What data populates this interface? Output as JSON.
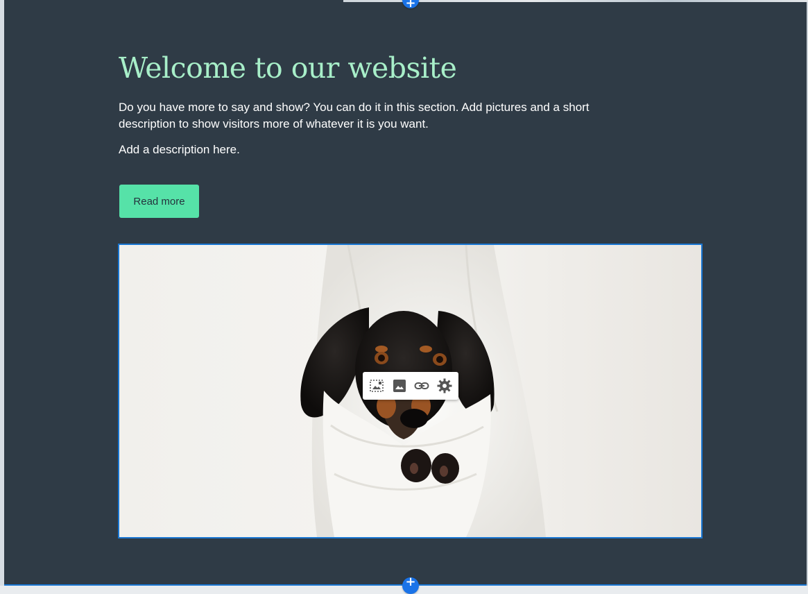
{
  "section": {
    "title": "Welcome to our website",
    "description": "Do you have more to say and show? You can do it in this section. Add pictures and a short description to show visitors more of whatever it is you want.",
    "description2": "Add a description here.",
    "button_label": "Read more"
  },
  "editor": {
    "add_section_symbol": "+",
    "image_toolbar": {
      "tools": [
        {
          "icon": "crop-image-icon"
        },
        {
          "icon": "replace-image-icon"
        },
        {
          "icon": "link-icon"
        },
        {
          "icon": "gear-icon"
        }
      ]
    }
  },
  "colors": {
    "section_background": "#2f3b46",
    "title": "#a8efc9",
    "button": "#56e2a8",
    "selection": "#1976d2"
  }
}
